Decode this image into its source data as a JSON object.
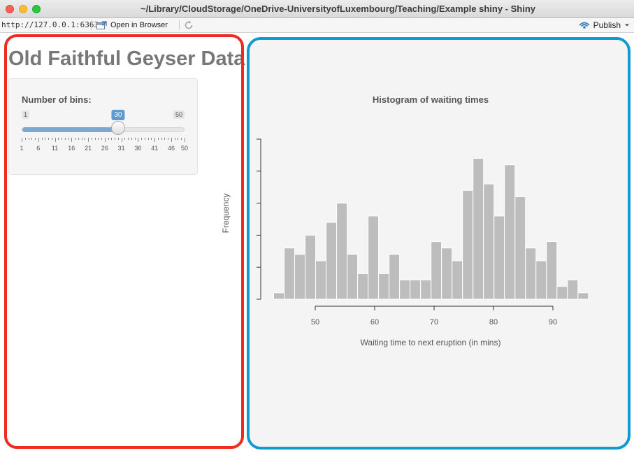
{
  "window": {
    "title": "~/Library/CloudStorage/OneDrive-UniversityofLuxembourg/Teaching/Example shiny - Shiny"
  },
  "toolbar": {
    "url": "http://127.0.0.1:6363",
    "open_in_browser_label": "Open in Browser",
    "publish_label": "Publish"
  },
  "app": {
    "title": "Old Faithful Geyser Data"
  },
  "slider": {
    "label": "Number of bins:",
    "min": 1,
    "max": 50,
    "value": 30,
    "value_label": "30",
    "min_label": "1",
    "max_label": "50",
    "grid_labels": [
      "1",
      "6",
      "11",
      "16",
      "21",
      "26",
      "31",
      "36",
      "41",
      "46",
      "50"
    ],
    "fill_color": "#7fa6cc"
  },
  "chart_data": {
    "type": "bar",
    "title": "Histogram of waiting times",
    "xlabel": "Waiting time to next eruption (in mins)",
    "ylabel": "Frequency",
    "x_ticks": [
      50,
      60,
      70,
      80,
      90
    ],
    "bin_start": 43,
    "bin_width": 1.766,
    "values": [
      1,
      8,
      7,
      10,
      6,
      12,
      15,
      7,
      4,
      13,
      4,
      7,
      3,
      3,
      3,
      9,
      8,
      6,
      17,
      22,
      18,
      13,
      21,
      16,
      8,
      6,
      9,
      2,
      3,
      1
    ],
    "ylim": [
      0,
      25
    ],
    "bar_color": "#bdbdbd"
  }
}
